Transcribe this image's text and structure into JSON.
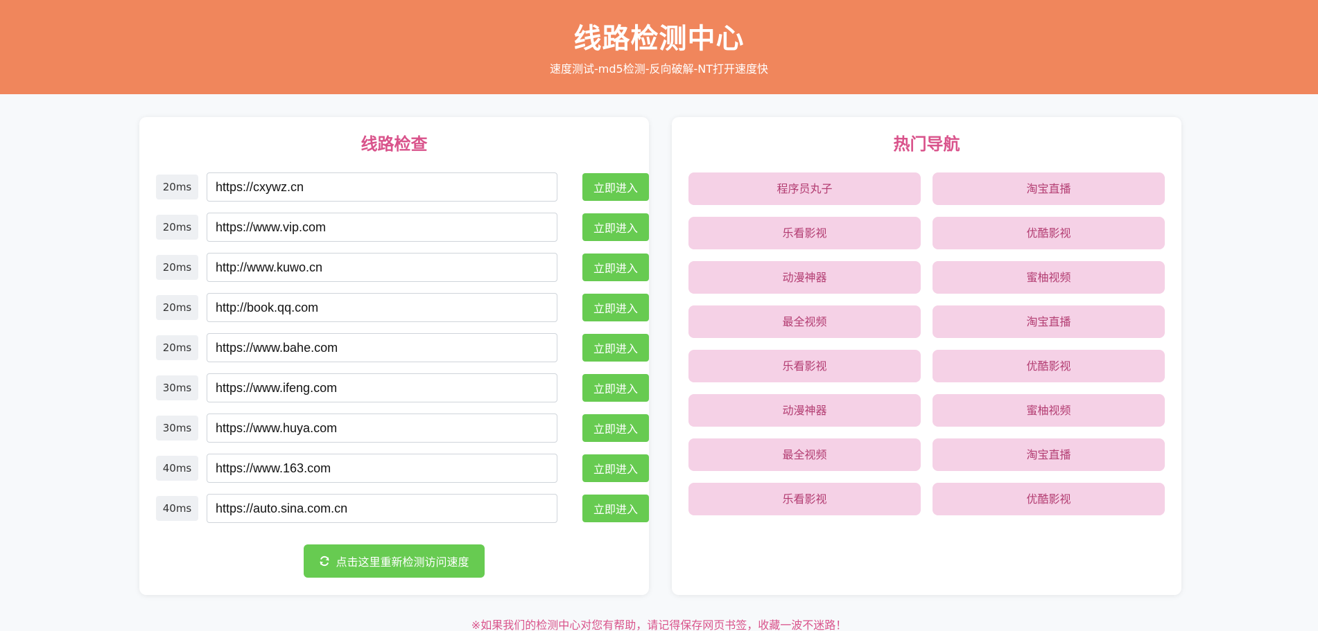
{
  "header": {
    "title": "线路检测中心",
    "subtitle": "速度测试-md5检测-反向破解-NT打开速度快"
  },
  "check_panel": {
    "title": "线路检查",
    "rows": [
      {
        "ms": "20ms",
        "url": "https://cxywz.cn",
        "button": "立即进入"
      },
      {
        "ms": "20ms",
        "url": "https://www.vip.com",
        "button": "立即进入"
      },
      {
        "ms": "20ms",
        "url": "http://www.kuwo.cn",
        "button": "立即进入"
      },
      {
        "ms": "20ms",
        "url": "http://book.qq.com",
        "button": "立即进入"
      },
      {
        "ms": "20ms",
        "url": "https://www.bahe.com",
        "button": "立即进入"
      },
      {
        "ms": "30ms",
        "url": "https://www.ifeng.com",
        "button": "立即进入"
      },
      {
        "ms": "30ms",
        "url": "https://www.huya.com",
        "button": "立即进入"
      },
      {
        "ms": "40ms",
        "url": "https://www.163.com",
        "button": "立即进入"
      },
      {
        "ms": "40ms",
        "url": "https://auto.sina.com.cn",
        "button": "立即进入"
      }
    ],
    "recheck_label": "点击这里重新检测访问速度",
    "recheck_icon": "refresh-icon"
  },
  "nav_panel": {
    "title": "热门导航",
    "items": [
      "程序员丸子",
      "淘宝直播",
      "乐看影视",
      "优酷影视",
      "动漫神器",
      "蜜柚视频",
      "最全视频",
      "淘宝直播",
      "乐看影视",
      "优酷影视",
      "动漫神器",
      "蜜柚视频",
      "最全视频",
      "淘宝直播",
      "乐看影视",
      "优酷影视"
    ]
  },
  "footer": {
    "note": "※如果我们的检测中心对您有帮助，请记得保存网页书签，收藏一波不迷路！"
  },
  "colors": {
    "header_bg": "#f0865c",
    "accent_pink": "#d9538b",
    "button_green": "#67cb51",
    "nav_bg": "#f5d1e6"
  }
}
